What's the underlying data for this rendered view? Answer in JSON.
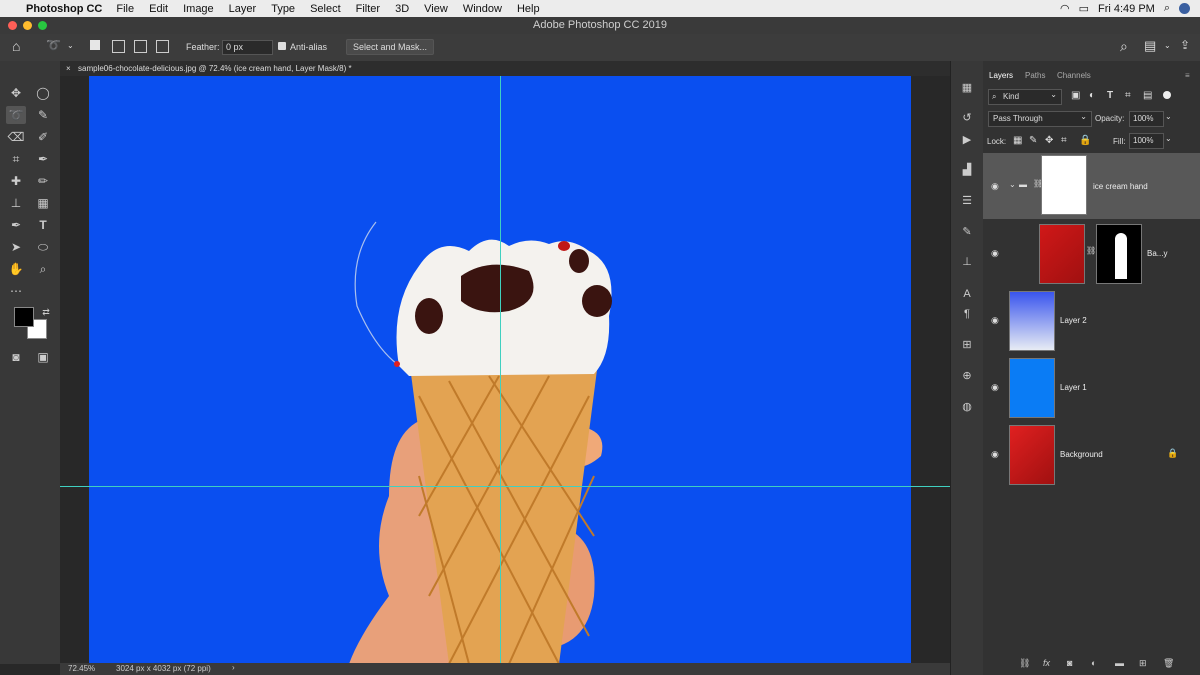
{
  "menubar": {
    "app": "Photoshop CC",
    "items": [
      "File",
      "Edit",
      "Image",
      "Layer",
      "Type",
      "Select",
      "Filter",
      "3D",
      "View",
      "Window",
      "Help"
    ],
    "clock": "Fri 4:49 PM"
  },
  "window": {
    "title": "Adobe Photoshop CC 2019"
  },
  "options": {
    "feather_label": "Feather:",
    "feather_value": "0 px",
    "antialias_label": "Anti-alias",
    "select_mask": "Select and Mask..."
  },
  "document": {
    "tab_title": "sample06-chocolate-delicious.jpg @ 72.4% (ice cream hand, Layer Mask/8) *"
  },
  "status": {
    "zoom": "72.45%",
    "doc_info": "3024 px x 4032 px (72 ppi)"
  },
  "layers_panel": {
    "tabs": [
      "Layers",
      "Paths",
      "Channels"
    ],
    "kind_label": "Kind",
    "blend_mode": "Pass Through",
    "opacity_label": "Opacity:",
    "opacity_value": "100%",
    "lock_label": "Lock:",
    "fill_label": "Fill:",
    "fill_value": "100%",
    "layers": [
      {
        "name": "ice cream hand",
        "type": "group"
      },
      {
        "name": "Ba...y",
        "type": "masked"
      },
      {
        "name": "Layer 2",
        "type": "gradient"
      },
      {
        "name": "Layer 1",
        "type": "fill"
      },
      {
        "name": "Background",
        "type": "image"
      }
    ]
  },
  "colors": {
    "canvas_blue": "#0a4ff0",
    "guide": "#40d0c0",
    "selected_layer": "#585858"
  }
}
